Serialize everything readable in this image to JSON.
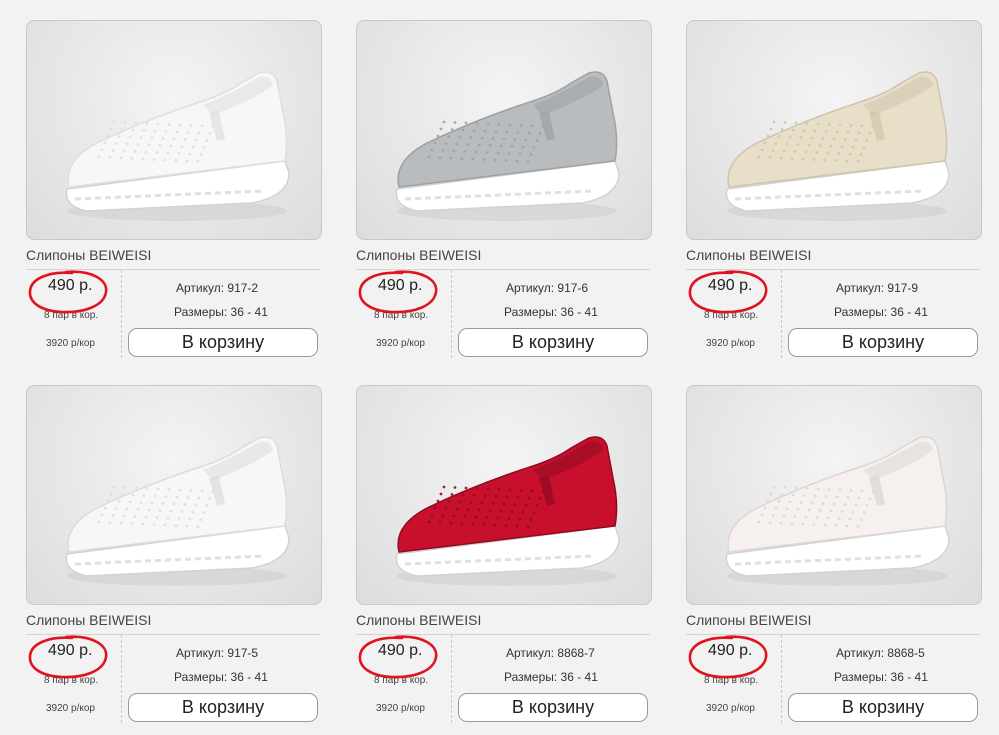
{
  "products": [
    {
      "name": "Слипоны BEIWEISI",
      "price": "490 р.",
      "pairs": "8 пар в кор.",
      "box_price": "3920 р/кор",
      "sku": "Артикул: 917-2",
      "sizes": "Размеры: 36 - 41",
      "button": "В корзину",
      "shoe_color": "#f7f7f7",
      "shoe_shade": "#dedede"
    },
    {
      "name": "Слипоны BEIWEISI",
      "price": "490 р.",
      "pairs": "8 пар в кор.",
      "box_price": "3920 р/кор",
      "sku": "Артикул: 917-6",
      "sizes": "Размеры: 36 - 41",
      "button": "В корзину",
      "shoe_color": "#b9bcbe",
      "shoe_shade": "#9ea1a3"
    },
    {
      "name": "Слипоны BEIWEISI",
      "price": "490 р.",
      "pairs": "8 пар в кор.",
      "box_price": "3920 р/кор",
      "sku": "Артикул: 917-9",
      "sizes": "Размеры: 36 - 41",
      "button": "В корзину",
      "shoe_color": "#e8dfc9",
      "shoe_shade": "#cfc5ad"
    },
    {
      "name": "Слипоны BEIWEISI",
      "price": "490 р.",
      "pairs": "8 пар в кор.",
      "box_price": "3920 р/кор",
      "sku": "Артикул: 917-5",
      "sizes": "Размеры: 36 - 41",
      "button": "В корзину",
      "shoe_color": "#f7f7f7",
      "shoe_shade": "#dcdcdc"
    },
    {
      "name": "Слипоны BEIWEISI",
      "price": "490 р.",
      "pairs": "8 пар в кор.",
      "box_price": "3920 р/кор",
      "sku": "Артикул: 8868-7",
      "sizes": "Размеры: 36 - 41",
      "button": "В корзину",
      "shoe_color": "#c8102e",
      "shoe_shade": "#8e0c20"
    },
    {
      "name": "Слипоны BEIWEISI",
      "price": "490 р.",
      "pairs": "8 пар в кор.",
      "box_price": "3920 р/кор",
      "sku": "Артикул: 8868-5",
      "sizes": "Размеры: 36 - 41",
      "button": "В корзину",
      "shoe_color": "#f6f1ef",
      "shoe_shade": "#ddd6d3"
    }
  ],
  "annotation_color": "#e0141e"
}
